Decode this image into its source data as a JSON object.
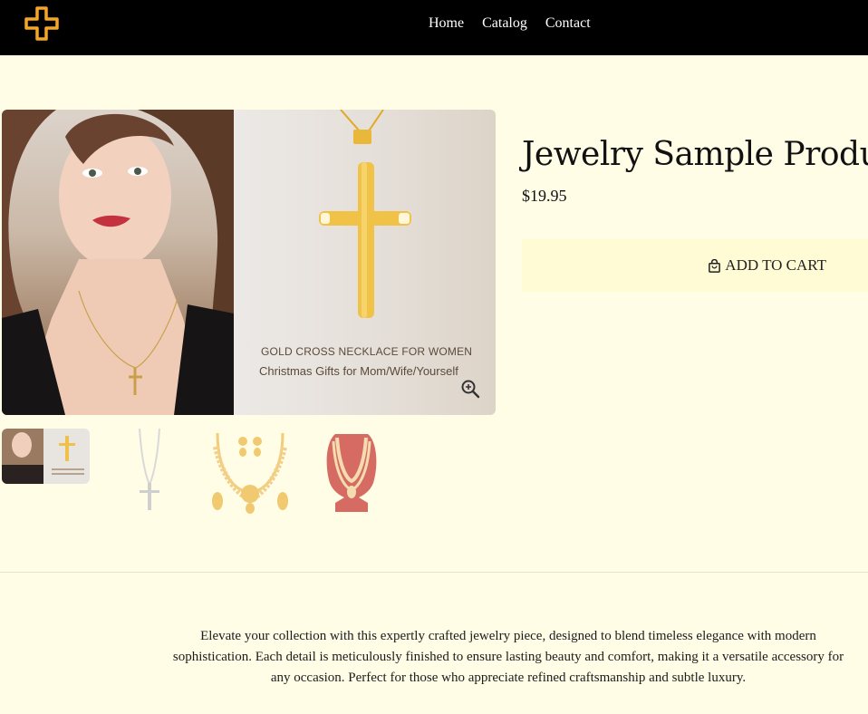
{
  "header": {
    "logo_icon": "cross-logo-icon",
    "nav": [
      "Home",
      "Catalog",
      "Contact"
    ]
  },
  "gallery": {
    "main_image": {
      "caption_line1": "GOLD CROSS NECKLACE FOR  WOMEN",
      "caption_line2": "Christmas Gifts for Mom/Wife/Yourself",
      "zoom_icon": "zoom-in-icon"
    },
    "thumbnails": [
      "gold-cross-necklace",
      "silver-cross-necklace",
      "gold-necklace-earring-set",
      "gold-necklace-on-bust"
    ]
  },
  "product": {
    "title": "Jewelry Sample Product",
    "price": "$19.95",
    "add_to_cart": "ADD TO CART",
    "cart_icon": "shopping-bag-icon"
  },
  "description": "Elevate your collection with this expertly crafted jewelry piece, designed to blend timeless elegance with modern sophistication. Each detail is meticulously finished to ensure lasting beauty and comfort, making it a versatile accessory for any occasion. Perfect for those who appreciate refined craftsmanship and subtle luxury.",
  "colors": {
    "header_bg": "#000000",
    "page_bg": "#fffde6",
    "accent": "#f5a623",
    "button_bg": "#fffbd5"
  }
}
